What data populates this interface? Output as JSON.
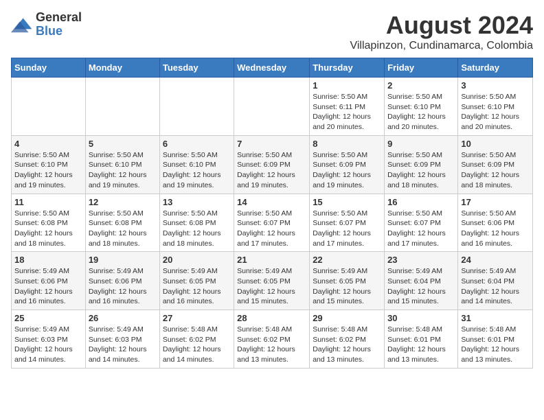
{
  "logo": {
    "general": "General",
    "blue": "Blue"
  },
  "title": {
    "month_year": "August 2024",
    "location": "Villapinzon, Cundinamarca, Colombia"
  },
  "weekdays": [
    "Sunday",
    "Monday",
    "Tuesday",
    "Wednesday",
    "Thursday",
    "Friday",
    "Saturday"
  ],
  "weeks": [
    [
      {
        "day": "",
        "detail": ""
      },
      {
        "day": "",
        "detail": ""
      },
      {
        "day": "",
        "detail": ""
      },
      {
        "day": "",
        "detail": ""
      },
      {
        "day": "1",
        "detail": "Sunrise: 5:50 AM\nSunset: 6:11 PM\nDaylight: 12 hours\nand 20 minutes."
      },
      {
        "day": "2",
        "detail": "Sunrise: 5:50 AM\nSunset: 6:10 PM\nDaylight: 12 hours\nand 20 minutes."
      },
      {
        "day": "3",
        "detail": "Sunrise: 5:50 AM\nSunset: 6:10 PM\nDaylight: 12 hours\nand 20 minutes."
      }
    ],
    [
      {
        "day": "4",
        "detail": "Sunrise: 5:50 AM\nSunset: 6:10 PM\nDaylight: 12 hours\nand 19 minutes."
      },
      {
        "day": "5",
        "detail": "Sunrise: 5:50 AM\nSunset: 6:10 PM\nDaylight: 12 hours\nand 19 minutes."
      },
      {
        "day": "6",
        "detail": "Sunrise: 5:50 AM\nSunset: 6:10 PM\nDaylight: 12 hours\nand 19 minutes."
      },
      {
        "day": "7",
        "detail": "Sunrise: 5:50 AM\nSunset: 6:09 PM\nDaylight: 12 hours\nand 19 minutes."
      },
      {
        "day": "8",
        "detail": "Sunrise: 5:50 AM\nSunset: 6:09 PM\nDaylight: 12 hours\nand 19 minutes."
      },
      {
        "day": "9",
        "detail": "Sunrise: 5:50 AM\nSunset: 6:09 PM\nDaylight: 12 hours\nand 18 minutes."
      },
      {
        "day": "10",
        "detail": "Sunrise: 5:50 AM\nSunset: 6:09 PM\nDaylight: 12 hours\nand 18 minutes."
      }
    ],
    [
      {
        "day": "11",
        "detail": "Sunrise: 5:50 AM\nSunset: 6:08 PM\nDaylight: 12 hours\nand 18 minutes."
      },
      {
        "day": "12",
        "detail": "Sunrise: 5:50 AM\nSunset: 6:08 PM\nDaylight: 12 hours\nand 18 minutes."
      },
      {
        "day": "13",
        "detail": "Sunrise: 5:50 AM\nSunset: 6:08 PM\nDaylight: 12 hours\nand 18 minutes."
      },
      {
        "day": "14",
        "detail": "Sunrise: 5:50 AM\nSunset: 6:07 PM\nDaylight: 12 hours\nand 17 minutes."
      },
      {
        "day": "15",
        "detail": "Sunrise: 5:50 AM\nSunset: 6:07 PM\nDaylight: 12 hours\nand 17 minutes."
      },
      {
        "day": "16",
        "detail": "Sunrise: 5:50 AM\nSunset: 6:07 PM\nDaylight: 12 hours\nand 17 minutes."
      },
      {
        "day": "17",
        "detail": "Sunrise: 5:50 AM\nSunset: 6:06 PM\nDaylight: 12 hours\nand 16 minutes."
      }
    ],
    [
      {
        "day": "18",
        "detail": "Sunrise: 5:49 AM\nSunset: 6:06 PM\nDaylight: 12 hours\nand 16 minutes."
      },
      {
        "day": "19",
        "detail": "Sunrise: 5:49 AM\nSunset: 6:06 PM\nDaylight: 12 hours\nand 16 minutes."
      },
      {
        "day": "20",
        "detail": "Sunrise: 5:49 AM\nSunset: 6:05 PM\nDaylight: 12 hours\nand 16 minutes."
      },
      {
        "day": "21",
        "detail": "Sunrise: 5:49 AM\nSunset: 6:05 PM\nDaylight: 12 hours\nand 15 minutes."
      },
      {
        "day": "22",
        "detail": "Sunrise: 5:49 AM\nSunset: 6:05 PM\nDaylight: 12 hours\nand 15 minutes."
      },
      {
        "day": "23",
        "detail": "Sunrise: 5:49 AM\nSunset: 6:04 PM\nDaylight: 12 hours\nand 15 minutes."
      },
      {
        "day": "24",
        "detail": "Sunrise: 5:49 AM\nSunset: 6:04 PM\nDaylight: 12 hours\nand 14 minutes."
      }
    ],
    [
      {
        "day": "25",
        "detail": "Sunrise: 5:49 AM\nSunset: 6:03 PM\nDaylight: 12 hours\nand 14 minutes."
      },
      {
        "day": "26",
        "detail": "Sunrise: 5:49 AM\nSunset: 6:03 PM\nDaylight: 12 hours\nand 14 minutes."
      },
      {
        "day": "27",
        "detail": "Sunrise: 5:48 AM\nSunset: 6:02 PM\nDaylight: 12 hours\nand 14 minutes."
      },
      {
        "day": "28",
        "detail": "Sunrise: 5:48 AM\nSunset: 6:02 PM\nDaylight: 12 hours\nand 13 minutes."
      },
      {
        "day": "29",
        "detail": "Sunrise: 5:48 AM\nSunset: 6:02 PM\nDaylight: 12 hours\nand 13 minutes."
      },
      {
        "day": "30",
        "detail": "Sunrise: 5:48 AM\nSunset: 6:01 PM\nDaylight: 12 hours\nand 13 minutes."
      },
      {
        "day": "31",
        "detail": "Sunrise: 5:48 AM\nSunset: 6:01 PM\nDaylight: 12 hours\nand 13 minutes."
      }
    ]
  ]
}
